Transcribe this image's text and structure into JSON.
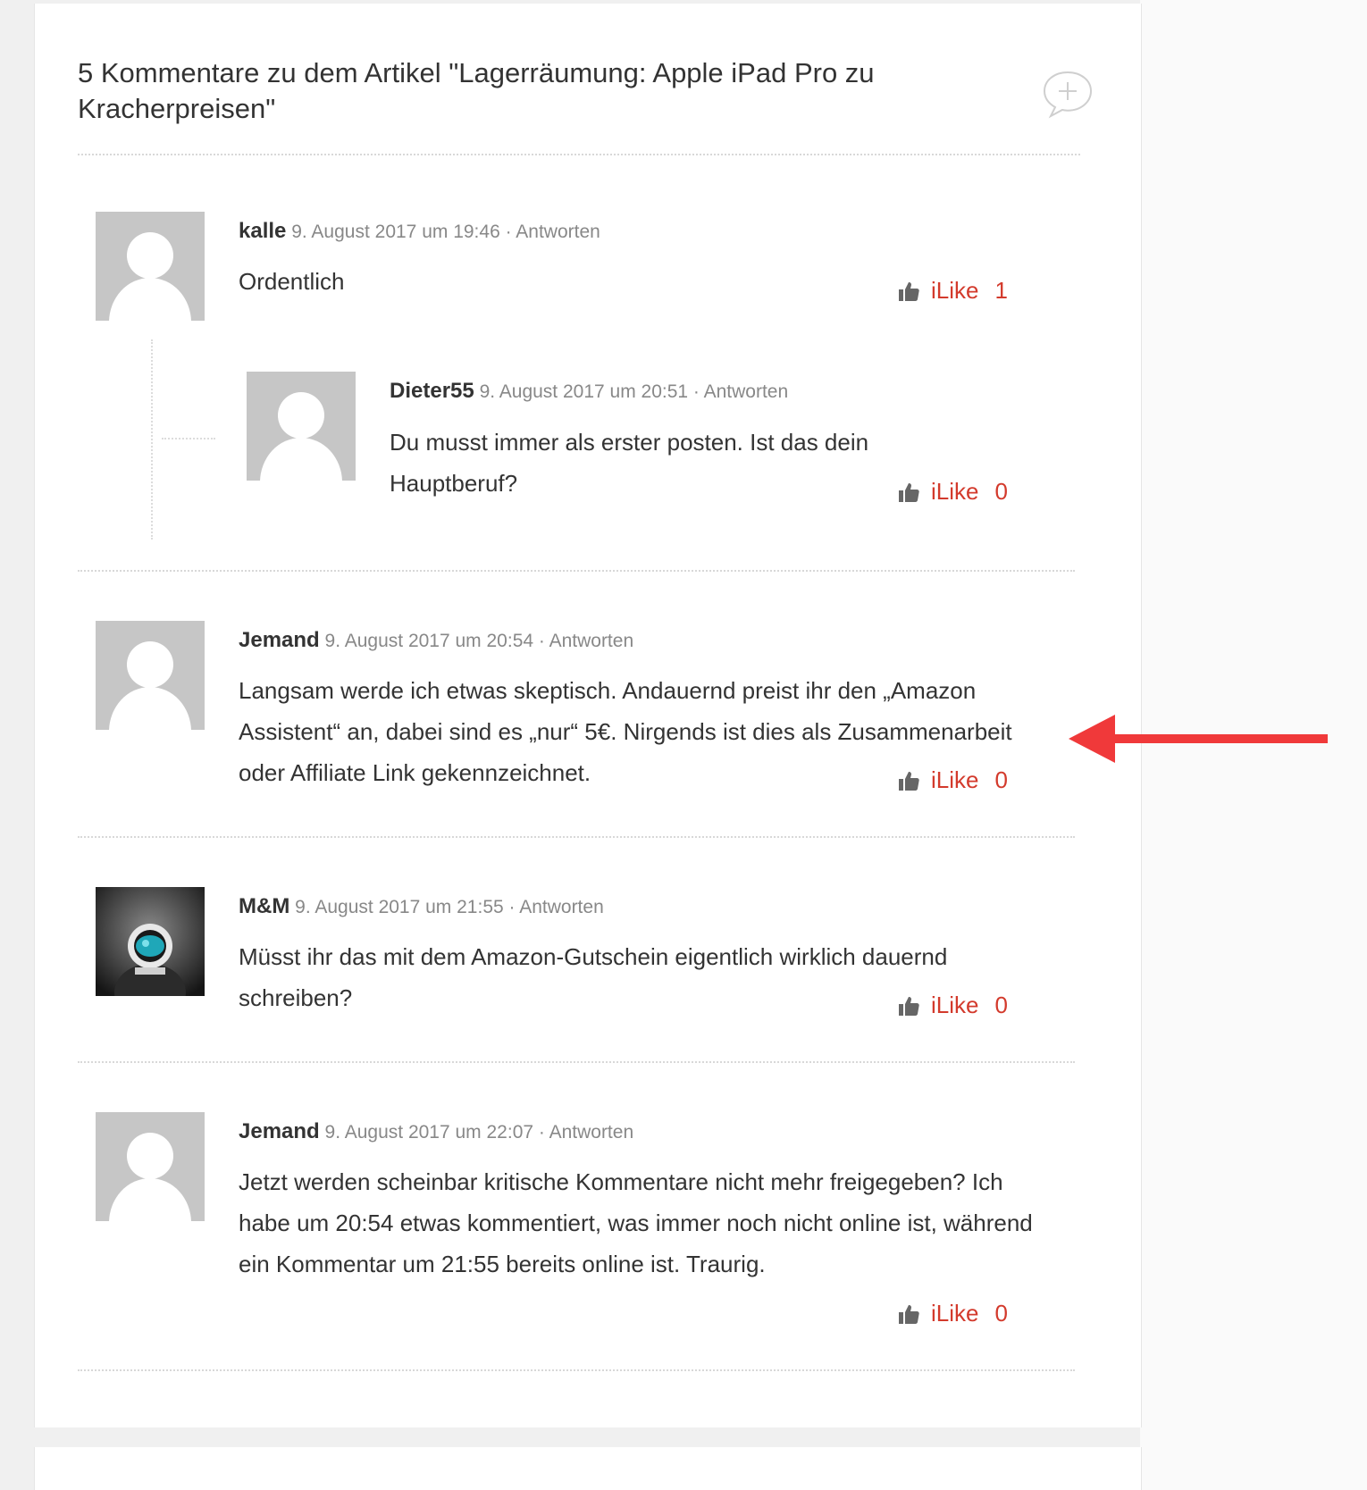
{
  "section": {
    "title": "5 Kommentare zu dem Artikel \"Lagerräumung: Apple iPad Pro zu Kracherpreisen\""
  },
  "icons": {
    "add_comment": "comment-bubble-plus-icon",
    "like": "thumbs-up-icon",
    "avatar_default": "default-user-silhouette",
    "avatar_mm": "astronaut-photo"
  },
  "colors": {
    "like": "#d33a2c",
    "arrow": "#f0393a",
    "avatar_bg": "#c6c6c6"
  },
  "comments": [
    {
      "author": "kalle",
      "date": "9. August 2017 um 19:46",
      "separator": " · ",
      "reply_label": "Antworten",
      "text": "Ordentlich",
      "like_label": "iLike",
      "like_count": "1"
    },
    {
      "author": "Dieter55",
      "date": "9. August 2017 um 20:51",
      "separator": " · ",
      "reply_label": "Antworten",
      "text": "Du musst immer als erster posten. Ist das dein Hauptberuf?",
      "like_label": "iLike",
      "like_count": "0"
    },
    {
      "author": "Jemand",
      "date": "9. August 2017 um 20:54",
      "separator": " · ",
      "reply_label": "Antworten",
      "text": "Langsam werde ich etwas skeptisch. Andauernd preist ihr den „Amazon Assistent“ an, dabei sind es „nur“ 5€. Nirgends ist dies als Zusammenarbeit oder Affiliate Link gekennzeichnet.",
      "like_label": "iLike",
      "like_count": "0"
    },
    {
      "author": "M&M",
      "date": "9. August 2017 um 21:55",
      "separator": " · ",
      "reply_label": "Antworten",
      "text": "Müsst ihr das mit dem Amazon-Gutschein eigentlich wirklich dauernd schreiben?",
      "like_label": "iLike",
      "like_count": "0"
    },
    {
      "author": "Jemand",
      "date": "9. August 2017 um 22:07",
      "separator": " · ",
      "reply_label": "Antworten",
      "text": "Jetzt werden scheinbar kritische Kommentare nicht mehr freigegeben? Ich habe um 20:54 etwas kommentiert, was immer noch nicht online ist, während ein Kommentar um 21:55 bereits online ist. Traurig.",
      "like_label": "iLike",
      "like_count": "0"
    }
  ]
}
